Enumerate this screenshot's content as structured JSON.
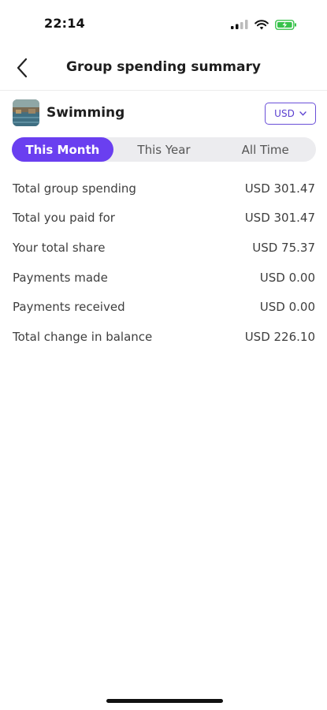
{
  "status_bar": {
    "time": "22:14"
  },
  "nav": {
    "title": "Group spending summary"
  },
  "group": {
    "name": "Swimming",
    "currency": "USD"
  },
  "tabs": [
    {
      "label": "This Month",
      "active": true
    },
    {
      "label": "This Year",
      "active": false
    },
    {
      "label": "All Time",
      "active": false
    }
  ],
  "summary": [
    {
      "label": "Total group spending",
      "value": "USD 301.47"
    },
    {
      "label": "Total you paid for",
      "value": "USD 301.47"
    },
    {
      "label": "Your total share",
      "value": "USD 75.37"
    },
    {
      "label": "Payments made",
      "value": "USD 0.00"
    },
    {
      "label": "Payments received",
      "value": "USD 0.00"
    },
    {
      "label": "Total change in balance",
      "value": "USD 226.10"
    }
  ],
  "colors": {
    "accent": "#6a3ff0",
    "segment_bg": "#ececef"
  },
  "icons": [
    "signal-icon",
    "wifi-icon",
    "battery-icon",
    "back-chevron-icon",
    "chevron-down-icon"
  ]
}
